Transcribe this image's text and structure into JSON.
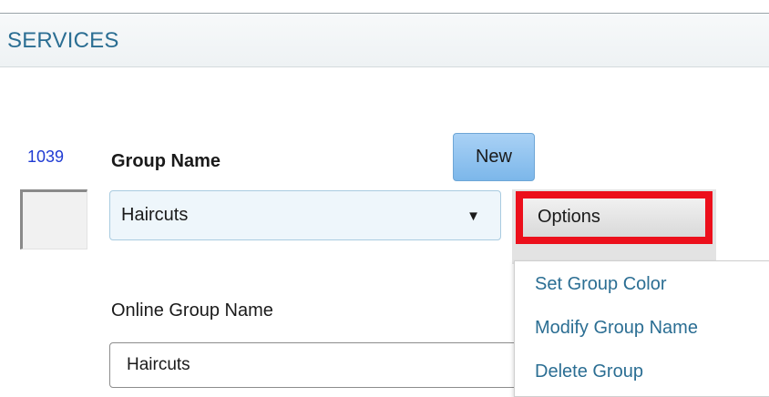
{
  "header": {
    "title": "SERVICES"
  },
  "group": {
    "id": "1039",
    "label": "Group Name",
    "selected": "Haircuts"
  },
  "buttons": {
    "new_label": "New",
    "options_label": "Options"
  },
  "online": {
    "label": "Online Group Name",
    "value": "Haircuts"
  },
  "options_menu": {
    "items": [
      "Set Group Color",
      "Modify Group Name",
      "Delete Group"
    ]
  },
  "colors": {
    "header_text": "#2b6e93",
    "id_text": "#1f3bd3",
    "highlight": "#ec0f1b",
    "new_button": "#7cb7ea"
  },
  "icons": {
    "dropdown": "chevron-down-icon"
  }
}
